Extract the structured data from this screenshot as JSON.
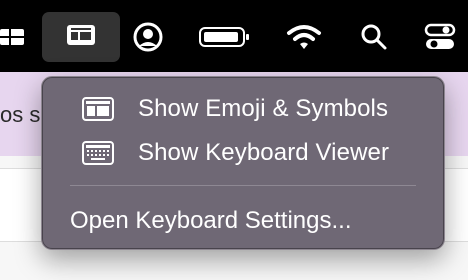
{
  "menubar": {
    "items": [
      {
        "name": "window-grid-icon"
      },
      {
        "name": "input-menu-icon"
      },
      {
        "name": "user-account-icon"
      },
      {
        "name": "battery-icon"
      },
      {
        "name": "wifi-icon"
      },
      {
        "name": "search-icon"
      },
      {
        "name": "control-center-icon"
      }
    ]
  },
  "background": {
    "partial_text": "os s"
  },
  "menu": {
    "items": [
      {
        "label": "Show Emoji & Symbols",
        "icon": "emoji-symbols-icon"
      },
      {
        "label": "Show Keyboard Viewer",
        "icon": "keyboard-viewer-icon"
      }
    ],
    "settings_label": "Open Keyboard Settings..."
  },
  "colors": {
    "menubar_bg": "#000000",
    "menu_bg": "#6f6875",
    "purple_band": "#e7d6ef"
  }
}
